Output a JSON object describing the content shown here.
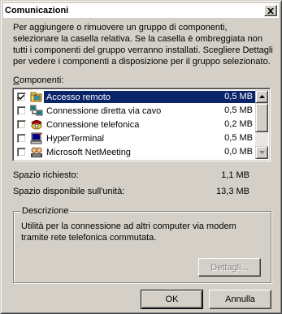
{
  "window": {
    "title": "Comunicazioni"
  },
  "intro_text": "Per aggiungere o rimuovere un gruppo di componenti, selezionare la casella relativa. Se la casella è ombreggiata non tutti i componenti del gruppo verranno installati. Scegliere Dettagli per vedere i componenti a disposizione per il gruppo selezionato.",
  "components": {
    "label_accel": "C",
    "label_rest": "omponenti:",
    "items": [
      {
        "name": "Accesso remoto",
        "size": "0,5 MB",
        "checked": true,
        "selected": true,
        "icon": "remote-access-icon"
      },
      {
        "name": "Connessione diretta via cavo",
        "size": "0,5 MB",
        "checked": false,
        "selected": false,
        "icon": "direct-cable-icon"
      },
      {
        "name": "Connessione telefonica",
        "size": "0,2 MB",
        "checked": false,
        "selected": false,
        "icon": "phone-dialer-icon"
      },
      {
        "name": "HyperTerminal",
        "size": "0,5 MB",
        "checked": false,
        "selected": false,
        "icon": "hyperterminal-icon"
      },
      {
        "name": "Microsoft NetMeeting",
        "size": "0,0 MB",
        "checked": false,
        "selected": false,
        "icon": "netmeeting-icon"
      }
    ]
  },
  "space": {
    "required_label": "Spazio richiesto:",
    "required_value": "1,1 MB",
    "available_label": "Spazio disponibile sull'unità:",
    "available_value": "13,3 MB"
  },
  "description": {
    "title": "Descrizione",
    "text": "Utilità per la connessione ad altri computer via modem tramite rete telefonica commutata."
  },
  "buttons": {
    "details": "Dettagli...",
    "ok": "OK",
    "cancel": "Annulla"
  },
  "colors": {
    "selection": "#0a246a",
    "face": "#d4d0c8"
  }
}
